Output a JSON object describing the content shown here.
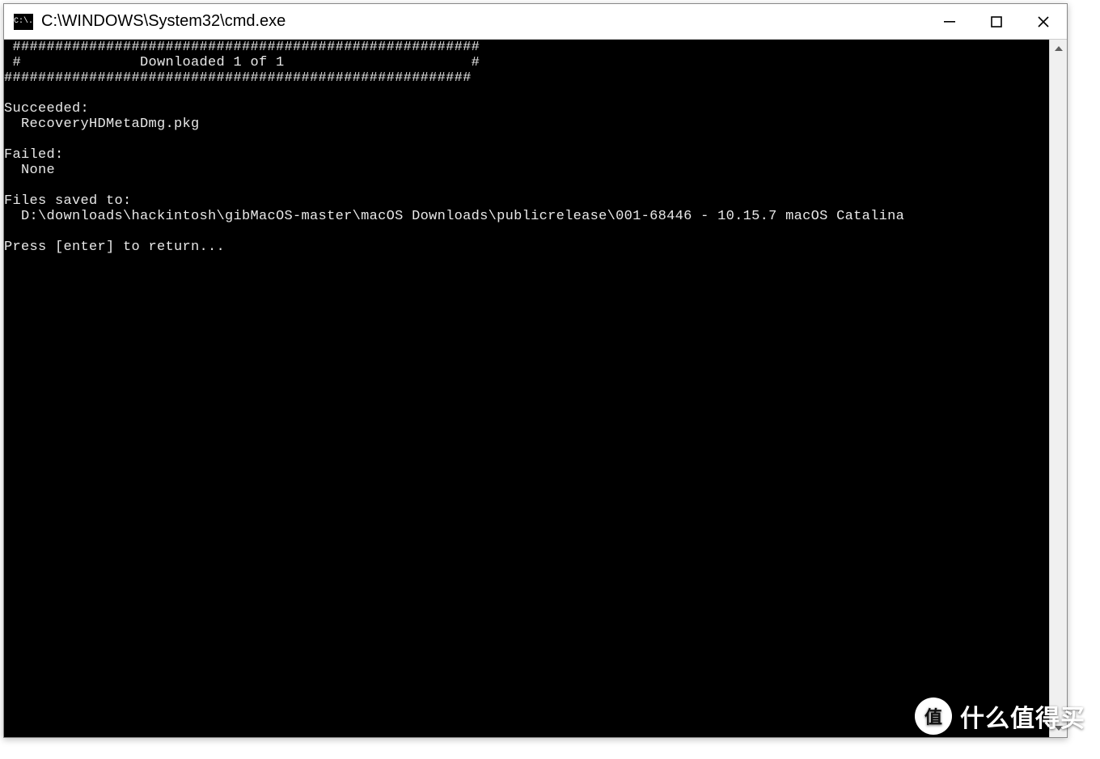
{
  "window": {
    "title": "C:\\WINDOWS\\System32\\cmd.exe",
    "icon_label": "C:\\."
  },
  "terminal": {
    "lines": [
      " #######################################################",
      " #              Downloaded 1 of 1                      #",
      "#######################################################",
      "",
      "Succeeded:",
      "  RecoveryHDMetaDmg.pkg",
      "",
      "Failed:",
      "  None",
      "",
      "Files saved to:",
      "  D:\\downloads\\hackintosh\\gibMacOS-master\\macOS Downloads\\publicrelease\\001-68446 - 10.15.7 macOS Catalina",
      "",
      "Press [enter] to return..."
    ]
  },
  "watermark": {
    "badge": "值",
    "text": "什么值得买"
  }
}
